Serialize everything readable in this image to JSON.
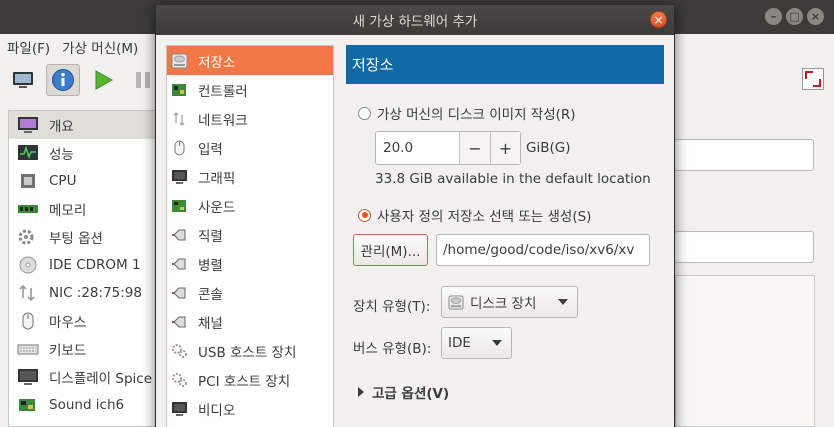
{
  "background_window": {
    "menu": [
      "파일(F)",
      "가상 머신(M)"
    ],
    "sidebar_items": [
      {
        "label": "개요",
        "icon": "monitor-overview-icon",
        "selected": true
      },
      {
        "label": "성능",
        "icon": "performance-graph-icon"
      },
      {
        "label": "CPU",
        "icon": "cpu-icon"
      },
      {
        "label": "메모리",
        "icon": "memory-icon"
      },
      {
        "label": "부팅 옵션",
        "icon": "gear-boot-icon"
      },
      {
        "label": "IDE CDROM 1",
        "icon": "cdrom-icon"
      },
      {
        "label": "NIC :28:75:98",
        "icon": "network-icon"
      },
      {
        "label": "마우스",
        "icon": "mouse-icon"
      },
      {
        "label": "키보드",
        "icon": "keyboard-icon"
      },
      {
        "label": "디스플레이 Spice",
        "icon": "display-icon"
      },
      {
        "label": "Sound ich6",
        "icon": "sound-card-icon"
      }
    ]
  },
  "dialog": {
    "title": "새 가상 하드웨어 추가",
    "close_symbol": "×",
    "hardware_list": [
      {
        "label": "저장소",
        "icon": "storage-icon",
        "selected": true
      },
      {
        "label": "컨트롤러",
        "icon": "controller-icon"
      },
      {
        "label": "네트워크",
        "icon": "network-icon"
      },
      {
        "label": "입력",
        "icon": "mouse-icon"
      },
      {
        "label": "그래픽",
        "icon": "display-icon"
      },
      {
        "label": "사운드",
        "icon": "sound-card-icon"
      },
      {
        "label": "직렬",
        "icon": "serial-port-icon"
      },
      {
        "label": "병렬",
        "icon": "parallel-port-icon"
      },
      {
        "label": "콘솔",
        "icon": "console-icon"
      },
      {
        "label": "채널",
        "icon": "channel-icon"
      },
      {
        "label": "USB 호스트 장치",
        "icon": "usb-host-icon"
      },
      {
        "label": "PCI 호스트 장치",
        "icon": "pci-host-icon"
      },
      {
        "label": "비디오",
        "icon": "video-icon"
      }
    ],
    "panel": {
      "header": "저장소",
      "create_disk_label": "가상 머신의 디스크 이미지 작성(R)",
      "create_disk_selected": false,
      "size_value": "20.0",
      "size_minus": "−",
      "size_plus": "+",
      "size_unit": "GiB(G)",
      "available_text": "33.8 GiB available in the default location",
      "custom_storage_label": "사용자 정의 저장소 선택 또는 생성(S)",
      "custom_storage_selected": true,
      "manage_button": "관리(M)...",
      "path_value": "/home/good/code/iso/xv6/xv",
      "device_type_label": "장치 유형(T):",
      "device_type_value": "디스크 장치",
      "bus_type_label": "버스 유형(B):",
      "bus_type_value": "IDE",
      "advanced_options": "고급 옵션(V)"
    }
  }
}
